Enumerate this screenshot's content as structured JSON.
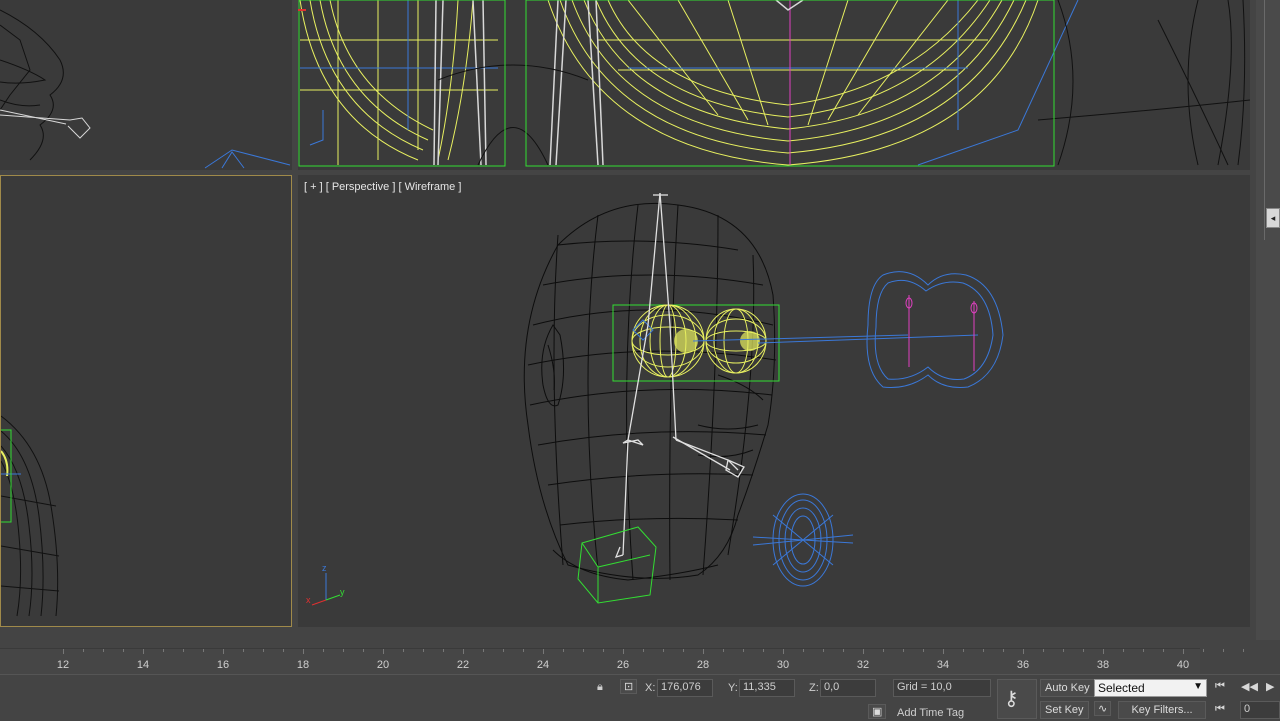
{
  "viewports": {
    "perspective_label": "[ + ] [ Perspective ] [ Wireframe ]"
  },
  "timeline": {
    "ticks": [
      "12",
      "14",
      "16",
      "18",
      "20",
      "22",
      "24",
      "26",
      "28",
      "30",
      "32",
      "34",
      "36",
      "38",
      "40"
    ]
  },
  "status": {
    "x_label": "X:",
    "x_value": "176,076",
    "y_label": "Y:",
    "y_value": "11,335",
    "z_label": "Z:",
    "z_value": "0,0",
    "grid": "Grid = 10,0",
    "add_time_tag": "Add Time Tag",
    "auto_key": "Auto Key",
    "set_key": "Set Key",
    "selected": "Selected",
    "key_filters": "Key Filters...",
    "frame_value": "0"
  },
  "axes": {
    "x": "x",
    "y": "y",
    "z": "z"
  },
  "colors": {
    "viewport_bg": "#3a3a3a",
    "wire_black": "#111111",
    "selected_green": "#33dd33",
    "yellow_wire": "#e8f060",
    "blue_wire": "#3a78d8",
    "magenta": "#e040c0"
  }
}
